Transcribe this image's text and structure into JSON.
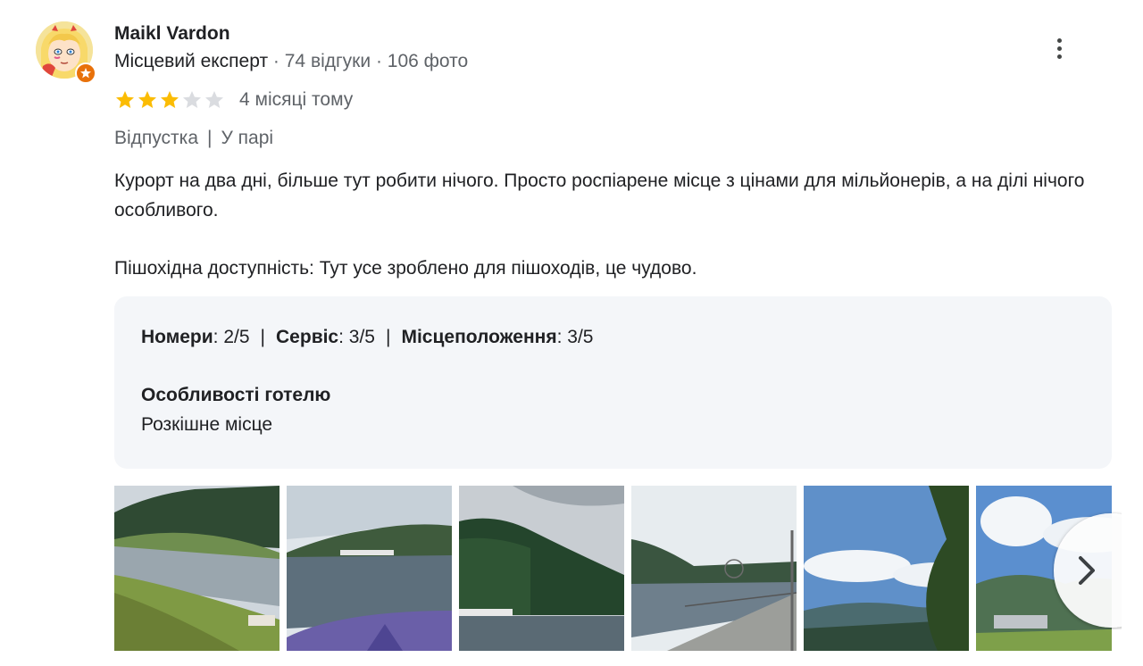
{
  "reviewer": {
    "name": "Maikl Vardon",
    "level": "Місцевий експерт",
    "separator": " · ",
    "reviews_count": "74 відгуки",
    "photos_count": "106 фото",
    "avatar_icon": "cartoon-avatar-icon",
    "badge_icon": "local-guide-badge-icon",
    "badge_color": "#e8710a"
  },
  "menu": {
    "icon": "more-vert-icon"
  },
  "rating": {
    "value": 3,
    "max": 5,
    "filled_color": "#fbbc04",
    "empty_color": "#dadce0"
  },
  "time_ago": "4 місяці тому",
  "trip": {
    "type": "Відпустка",
    "separator": "|",
    "companions": "У парі"
  },
  "review": {
    "text": "Курорт на два дні, більше тут робити нічого. Просто роспіарене місце з цінами для мільйонерів, а на ділі нічого особливого.",
    "accessibility": "Пішохідна доступність: Тут усе зроблено для пішоходів, це чудово."
  },
  "details": {
    "rooms_label": "Номери",
    "rooms_value": ": 2/5",
    "service_label": "Сервіс",
    "service_value": ": 3/5",
    "location_label": "Місцеположення",
    "location_value": ": 3/5",
    "pipe": "|",
    "features_title": "Особливості готелю",
    "features_value": "Розкішне місце"
  },
  "photos": [
    {
      "name": "lake-shore-slope"
    },
    {
      "name": "lake-mountains-boat"
    },
    {
      "name": "forested-hill-lake"
    },
    {
      "name": "promenade-ferris-wheel"
    },
    {
      "name": "mountain-view-spruce"
    },
    {
      "name": "valley-clouds"
    }
  ],
  "next_button": {
    "icon": "chevron-right-icon"
  }
}
